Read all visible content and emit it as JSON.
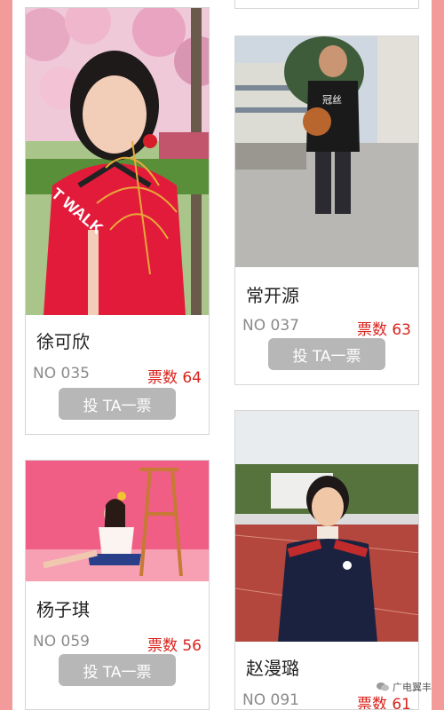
{
  "candidates": [
    {
      "name": "徐可欣",
      "no": "NO 035",
      "votes": "票数 64",
      "vote_btn": "投 TA一票",
      "shirt_text": "T WALK"
    },
    {
      "name": "常开源",
      "no": "NO 037",
      "votes": "票数 63",
      "vote_btn": "投 TA一票",
      "shirt_text": "冠丝"
    },
    {
      "name": "杨子琪",
      "no": "NO 059",
      "votes": "票数 56",
      "vote_btn": "投 TA一票"
    },
    {
      "name": "赵漫璐",
      "no": "NO 091",
      "votes": "票数 61"
    }
  ],
  "watermark": "广电翼丰",
  "colors": {
    "background": "#f39b9b",
    "votes": "#d9231d",
    "button": "#b7b7b7"
  }
}
